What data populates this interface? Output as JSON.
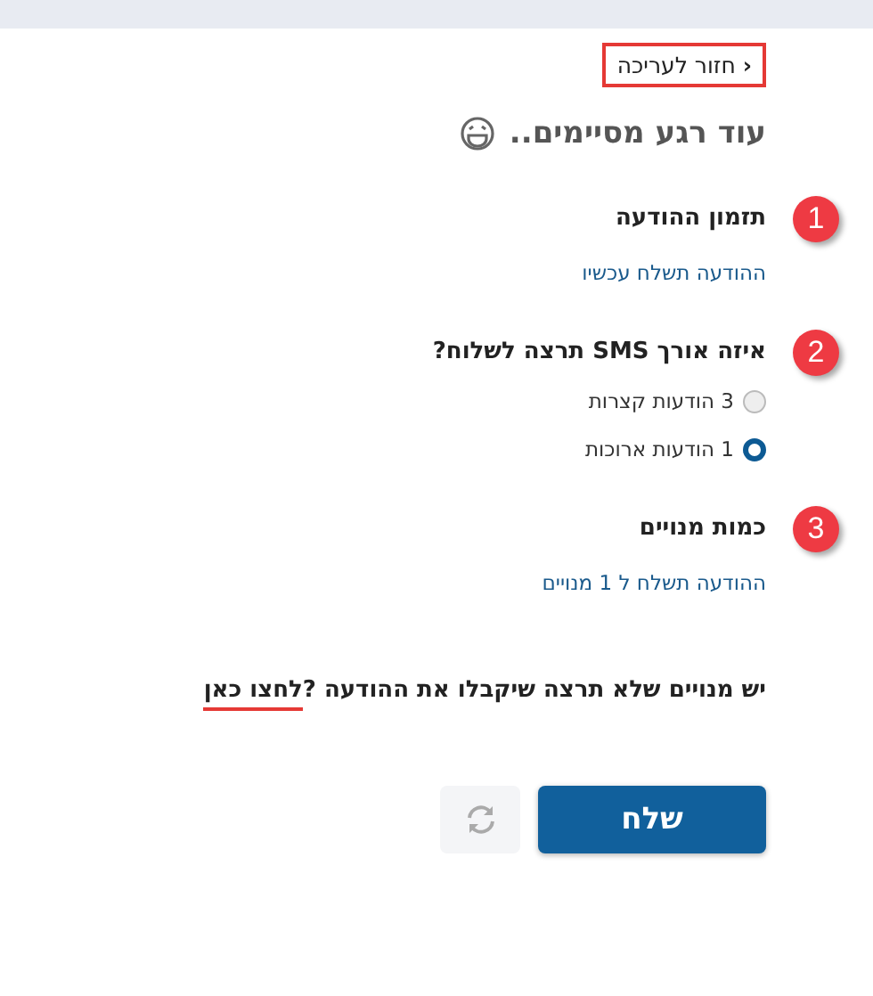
{
  "back_link": {
    "label": "חזור לעריכה",
    "icon": "‹"
  },
  "title": "עוד רגע מסיימים..",
  "sections": [
    {
      "number": "1",
      "heading": "תזמון ההודעה",
      "kind": "text",
      "text": "ההודעה תשלח עכשיו"
    },
    {
      "number": "2",
      "heading": "איזה אורך SMS תרצה לשלוח?",
      "kind": "radio",
      "options": [
        {
          "label": "3 הודעות קצרות",
          "selected": false
        },
        {
          "label": "1 הודעות ארוכות",
          "selected": true
        }
      ]
    },
    {
      "number": "3",
      "heading": "כמות מנויים",
      "kind": "text",
      "text": "ההודעה תשלח ל 1  מנויים"
    }
  ],
  "exclude": {
    "text": "יש מנויים שלא תרצה שיקבלו את ההודעה ?",
    "link": "לחצו כאן"
  },
  "buttons": {
    "send": "שלח"
  }
}
